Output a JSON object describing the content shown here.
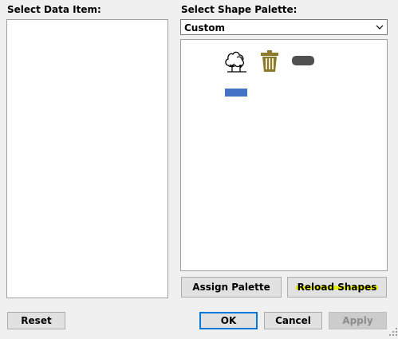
{
  "labels": {
    "select_data_item": "Select Data Item:",
    "select_shape_palette": "Select Shape Palette:"
  },
  "palette_dropdown": {
    "selected": "Custom",
    "chevron_icon": "chevron-down-icon"
  },
  "shapes": [
    {
      "name": "tree-shape-icon",
      "color": "#000000"
    },
    {
      "name": "trash-can-shape-icon",
      "color": "#8a7a2a"
    },
    {
      "name": "rounded-bar-shape-icon",
      "color": "#505050"
    },
    {
      "name": "rectangle-shape-icon",
      "color": "#4472c4"
    }
  ],
  "buttons": {
    "assign_palette": "Assign Palette",
    "reload_shapes": "Reload Shapes",
    "reset": "Reset",
    "ok": "OK",
    "cancel": "Cancel",
    "apply": "Apply"
  }
}
